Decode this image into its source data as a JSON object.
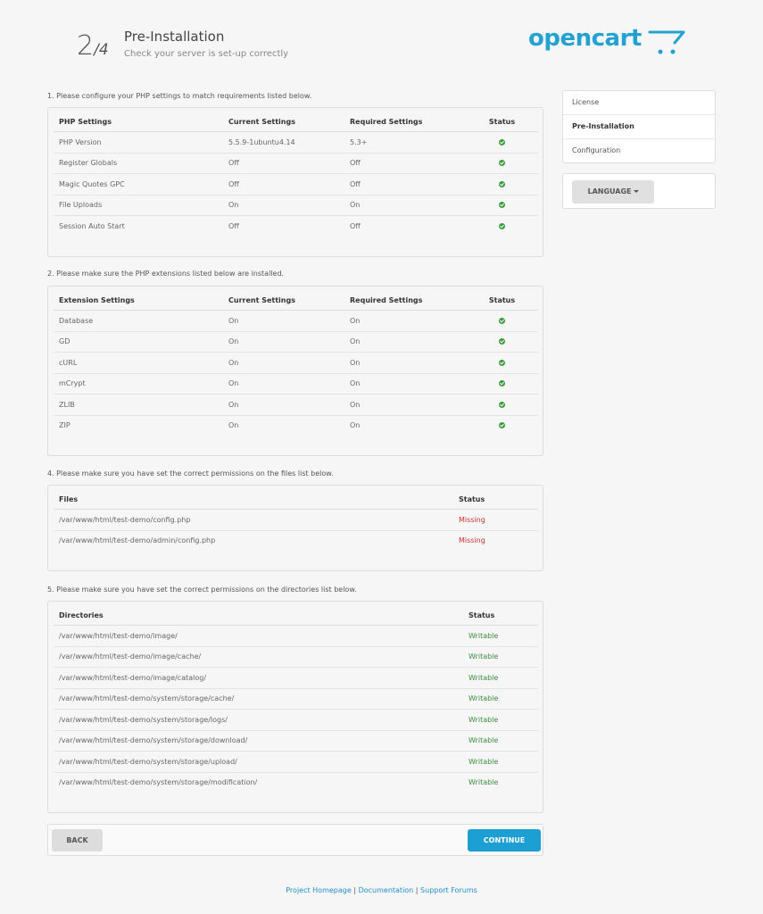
{
  "header": {
    "step_current": "2",
    "step_total": "/4",
    "title": "Pre-Installation",
    "subtitle": "Check your server is set-up correctly",
    "logo_text": "opencart"
  },
  "colors": {
    "brand": "#23a1d1",
    "ok": "#3c9a3c",
    "missing": "#c9302c",
    "writable": "#3c8d3c"
  },
  "php_settings": {
    "heading": "1. Please configure your PHP settings to match requirements listed below.",
    "columns": [
      "PHP Settings",
      "Current Settings",
      "Required Settings",
      "Status"
    ],
    "rows": [
      {
        "name": "PHP Version",
        "current": "5.5.9-1ubuntu4.14",
        "required": "5.3+",
        "status": "ok-icon"
      },
      {
        "name": "Register Globals",
        "current": "Off",
        "required": "Off",
        "status": "ok-icon"
      },
      {
        "name": "Magic Quotes GPC",
        "current": "Off",
        "required": "Off",
        "status": "ok-icon"
      },
      {
        "name": "File Uploads",
        "current": "On",
        "required": "On",
        "status": "ok-icon"
      },
      {
        "name": "Session Auto Start",
        "current": "Off",
        "required": "Off",
        "status": "ok-icon"
      }
    ]
  },
  "extensions": {
    "heading": "2. Please make sure the PHP extensions listed below are installed.",
    "columns": [
      "Extension Settings",
      "Current Settings",
      "Required Settings",
      "Status"
    ],
    "rows": [
      {
        "name": "Database",
        "current": "On",
        "required": "On",
        "status": "ok-icon"
      },
      {
        "name": "GD",
        "current": "On",
        "required": "On",
        "status": "ok-icon"
      },
      {
        "name": "cURL",
        "current": "On",
        "required": "On",
        "status": "ok-icon"
      },
      {
        "name": "mCrypt",
        "current": "On",
        "required": "On",
        "status": "ok-icon"
      },
      {
        "name": "ZLIB",
        "current": "On",
        "required": "On",
        "status": "ok-icon"
      },
      {
        "name": "ZIP",
        "current": "On",
        "required": "On",
        "status": "ok-icon"
      }
    ]
  },
  "files": {
    "heading": "4. Please make sure you have set the correct permissions on the files list below.",
    "columns": [
      "Files",
      "Status"
    ],
    "rows": [
      {
        "path": "/var/www/html/test-demo/config.php",
        "status": "Missing"
      },
      {
        "path": "/var/www/html/test-demo/admin/config.php",
        "status": "Missing"
      }
    ]
  },
  "directories": {
    "heading": "5. Please make sure you have set the correct permissions on the directories list below.",
    "columns": [
      "Directories",
      "Status"
    ],
    "rows": [
      {
        "path": "/var/www/html/test-demo/image/",
        "status": "Writable"
      },
      {
        "path": "/var/www/html/test-demo/image/cache/",
        "status": "Writable"
      },
      {
        "path": "/var/www/html/test-demo/image/catalog/",
        "status": "Writable"
      },
      {
        "path": "/var/www/html/test-demo/system/storage/cache/",
        "status": "Writable"
      },
      {
        "path": "/var/www/html/test-demo/system/storage/logs/",
        "status": "Writable"
      },
      {
        "path": "/var/www/html/test-demo/system/storage/download/",
        "status": "Writable"
      },
      {
        "path": "/var/www/html/test-demo/system/storage/upload/",
        "status": "Writable"
      },
      {
        "path": "/var/www/html/test-demo/system/storage/modification/",
        "status": "Writable"
      }
    ]
  },
  "sidebar": {
    "items": [
      {
        "label": "License",
        "active": false
      },
      {
        "label": "Pre-Installation",
        "active": true
      },
      {
        "label": "Configuration",
        "active": false
      }
    ],
    "language_label": "LANGUAGE"
  },
  "buttons": {
    "back": "BACK",
    "continue": "CONTINUE"
  },
  "footer": {
    "links": [
      "Project Homepage",
      "Documentation",
      "Support Forums"
    ],
    "separator": "|"
  }
}
